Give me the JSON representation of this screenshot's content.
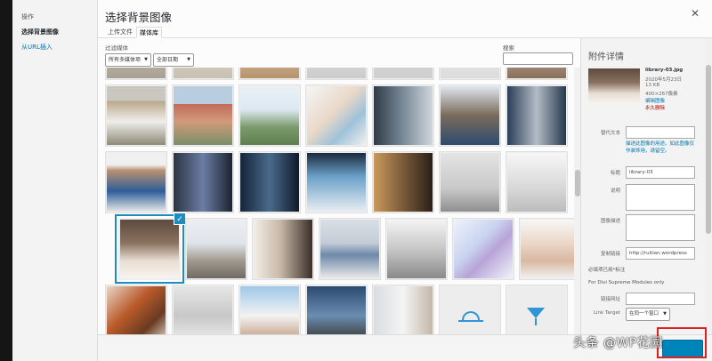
{
  "menu": {
    "items": [
      {
        "label": "操作",
        "state": "normal"
      },
      {
        "label": "选择背景图像",
        "state": "active"
      },
      {
        "label": "从URL插入",
        "state": "link"
      }
    ]
  },
  "modal": {
    "title": "选择背景图像",
    "close_icon": "close-icon"
  },
  "tabs": [
    {
      "label": "上传文件",
      "active": false
    },
    {
      "label": "媒体库",
      "active": true
    }
  ],
  "filters": {
    "label": "过滤媒体",
    "type_value": "所有多媒体项",
    "date_value": "全部日期",
    "search_label": "搜索",
    "search_value": ""
  },
  "details": {
    "heading": "附件详情",
    "filename": "library-03.jpg",
    "date": "2020年5月23日",
    "size": "13 KB",
    "dimensions": "400×267像素",
    "edit_link": "编辑图像",
    "delete_link": "永久删除",
    "alt_label": "替代文本",
    "alt_value": "",
    "alt_hint": "描述此图像的用途。如此图像仅作装饰用，请留空。",
    "title_label": "标题",
    "title_value": "library-03",
    "caption_label": "说明",
    "description_label": "图像描述",
    "copy_label": "复制链接",
    "copy_value": "http://ruitian.wordpress",
    "required_note": "必填项已用*标注",
    "module_note": "For Divi Supreme Modules only",
    "link_url_label": "链接网址",
    "link_url_value": "",
    "link_target_label": "Link Target",
    "link_target_value": "在同一个窗口"
  },
  "watermark": "头条 @WP花园",
  "colors": {
    "accent": "#0085ba",
    "selection": "#1e8cbe",
    "highlight_box": "#e02020"
  }
}
